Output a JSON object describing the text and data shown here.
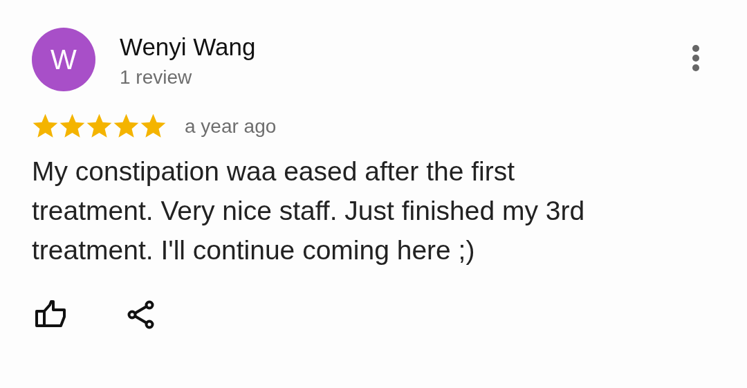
{
  "reviewer": {
    "initial": "W",
    "name": "Wenyi Wang",
    "review_count": "1 review"
  },
  "rating": {
    "stars": 5,
    "time": "a year ago"
  },
  "review_text": "My constipation waa eased after the first treatment. Very nice staff. Just finished my 3rd treatment. I'll continue coming here ;)"
}
